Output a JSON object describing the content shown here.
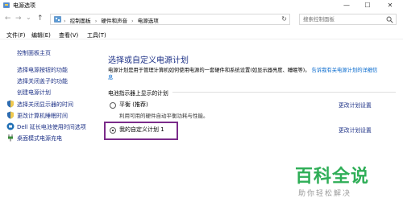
{
  "window": {
    "title": "电源选项",
    "controls": {
      "minimize": "—",
      "maximize": "☐",
      "close": "✕"
    }
  },
  "nav": {
    "back": "←",
    "forward": "→",
    "dropdown": "⌄",
    "up": "↑"
  },
  "address": {
    "crumbs": [
      "控制面板",
      "硬件和声音",
      "电源选项"
    ],
    "separator": "›",
    "refresh": "↻"
  },
  "search": {
    "placeholder": "搜索控制面板"
  },
  "menu": [
    "文件(F)",
    "编辑(E)",
    "查看(V)",
    "工具(T)"
  ],
  "sidebar": {
    "home": "控制面板主页",
    "links": [
      "选择电源按钮的功能",
      "选择关闭盖子的功能",
      "创建电源计划",
      "选择关闭显示器的时间",
      "更改计算机睡眠时间",
      "Dell 延长电池使用时间选项",
      "桌面模式电源充电"
    ]
  },
  "main": {
    "heading": "选择或自定义电源计划",
    "desc_text": "电源计划是用于管理计算机如何使用电源的一套硬件和系统设置(如显示器亮度、睡眠等)。",
    "desc_link": "告诉我有关电源计划的详细信息",
    "section_label": "电池指示器上显示的计划",
    "plans": [
      {
        "name": "平衡 (推荐)",
        "desc": "利用可用的硬件自动平衡功耗与性能。",
        "selected": false,
        "change": "更改计划设置"
      },
      {
        "name": "我的自定义计划 1",
        "desc": "",
        "selected": true,
        "change": "更改计划设置"
      }
    ]
  },
  "watermark": {
    "main": "百科全说",
    "sub": "助你轻松解决"
  },
  "colors": {
    "link": "#1e3287",
    "highlight": "#7b2c8a",
    "watermark": "#2fae57"
  }
}
